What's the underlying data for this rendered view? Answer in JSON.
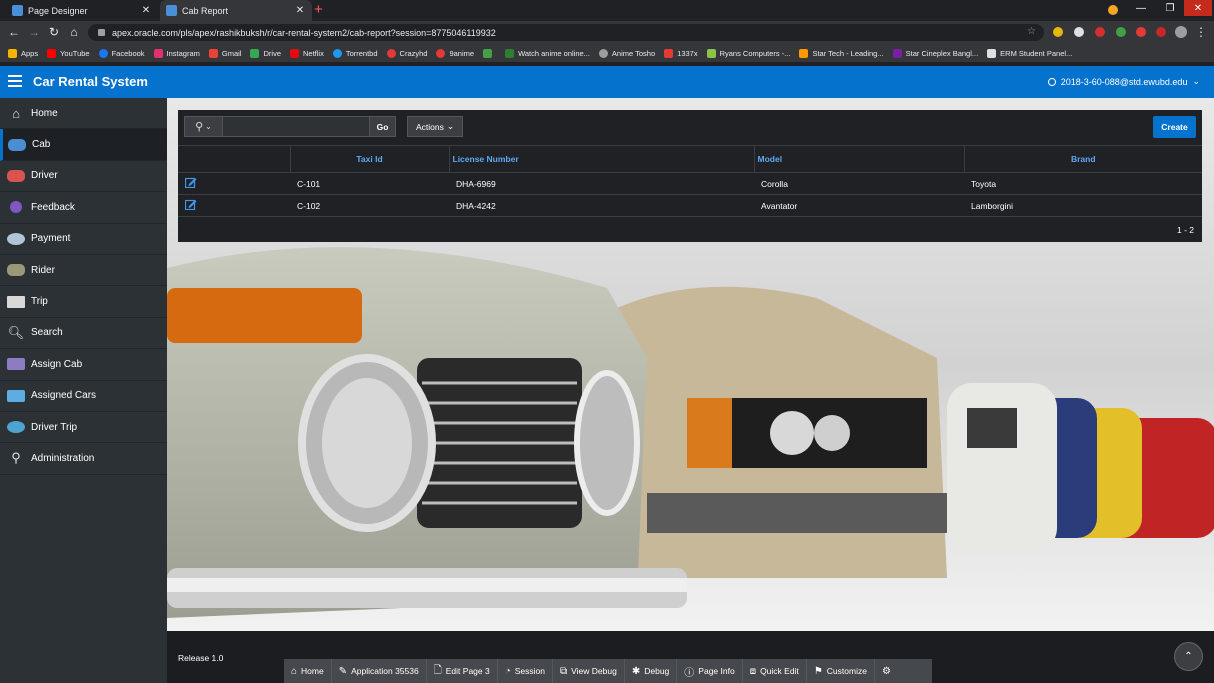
{
  "browser": {
    "tabs": [
      {
        "title": "Page Designer",
        "icon": "apex-icon",
        "color": "#4a90d9"
      },
      {
        "title": "Cab Report",
        "icon": "apex-icon",
        "color": "#4a90d9"
      }
    ],
    "url": "apex.oracle.com/pls/apex/rashikbuksh/r/car-rental-system2/cab-report?session=8775046119932",
    "bookmarks": [
      {
        "label": "Apps",
        "color": "#f4b400"
      },
      {
        "label": "YouTube",
        "color": "#ff0000"
      },
      {
        "label": "Facebook",
        "color": "#1877f2"
      },
      {
        "label": "Instagram",
        "color": "#e1306c"
      },
      {
        "label": "Gmail",
        "color": "#ea4335"
      },
      {
        "label": "Drive",
        "color": "#34a853"
      },
      {
        "label": "Netflix",
        "color": "#e50914"
      },
      {
        "label": "Torrentbd",
        "color": "#2196f3"
      },
      {
        "label": "Crazyhd",
        "color": "#e53935"
      },
      {
        "label": "9anime",
        "color": "#e53935"
      },
      {
        "label": "",
        "color": "#43a047"
      },
      {
        "label": "Watch anime online...",
        "color": "#2e7d32"
      },
      {
        "label": "Anime Tosho",
        "color": "#9e9e9e"
      },
      {
        "label": "1337x",
        "color": "#e53935"
      },
      {
        "label": "Ryans Computers -...",
        "color": "#8bc34a"
      },
      {
        "label": "Star Tech - Leading...",
        "color": "#ff9800"
      },
      {
        "label": "Star Cineplex Bangl...",
        "color": "#7b1fa2"
      },
      {
        "label": "ERM Student Panel...",
        "color": "#e0e0e0"
      }
    ]
  },
  "app": {
    "title": "Car Rental System",
    "user": "2018-3-60-088@std.ewubd.edu",
    "accent": "#0572ce"
  },
  "sidebar": {
    "items": [
      {
        "label": "Home",
        "icon": "home-icon",
        "active": false
      },
      {
        "label": "Cab",
        "icon": "cab-icon",
        "active": true
      },
      {
        "label": "Driver",
        "icon": "driver-icon",
        "active": false
      },
      {
        "label": "Feedback",
        "icon": "feedback-icon",
        "active": false
      },
      {
        "label": "Payment",
        "icon": "payment-icon",
        "active": false
      },
      {
        "label": "Rider",
        "icon": "rider-icon",
        "active": false
      },
      {
        "label": "Trip",
        "icon": "trip-icon",
        "active": false
      },
      {
        "label": "Search",
        "icon": "search-icon",
        "active": false
      },
      {
        "label": "Assign Cab",
        "icon": "assign-cab-icon",
        "active": false
      },
      {
        "label": "Assigned Cars",
        "icon": "assigned-cars-icon",
        "active": false
      },
      {
        "label": "Driver Trip",
        "icon": "driver-trip-icon",
        "active": false
      },
      {
        "label": "Administration",
        "icon": "administration-icon",
        "active": false
      }
    ]
  },
  "report": {
    "search_value": "",
    "go_label": "Go",
    "actions_label": "Actions",
    "create_label": "Create",
    "columns": [
      "Taxi Id",
      "License Number",
      "Model",
      "Brand"
    ],
    "rows": [
      {
        "taxi_id": "C-101",
        "license": "DHA-6969",
        "model": "Corolla",
        "brand": "Toyota"
      },
      {
        "taxi_id": "C-102",
        "license": "DHA-4242",
        "model": "Avantator",
        "brand": "Lamborgini"
      }
    ],
    "pagination": "1 - 2"
  },
  "footer": {
    "release": "Release 1.0",
    "devbar": [
      {
        "label": "Home",
        "icon": "home-icon"
      },
      {
        "label": "Application 35536",
        "icon": "edit-icon"
      },
      {
        "label": "Edit Page 3",
        "icon": "page-edit-icon"
      },
      {
        "label": "Session",
        "icon": "session-icon"
      },
      {
        "label": "View Debug",
        "icon": "view-debug-icon"
      },
      {
        "label": "Debug",
        "icon": "bug-icon"
      },
      {
        "label": "Page Info",
        "icon": "info-icon"
      },
      {
        "label": "Quick Edit",
        "icon": "quick-edit-icon"
      },
      {
        "label": "Customize",
        "icon": "customize-icon"
      },
      {
        "label": "",
        "icon": "gear-icon"
      }
    ]
  }
}
